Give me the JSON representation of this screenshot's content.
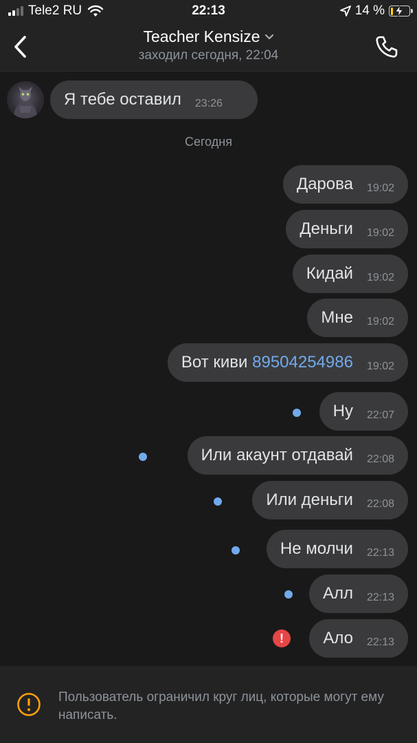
{
  "status_bar": {
    "carrier": "Tele2 RU",
    "time": "22:13",
    "battery": "14 %",
    "battery_level": 0.14
  },
  "header": {
    "title": "Teacher Kensize",
    "last_seen": "заходил сегодня, 22:04"
  },
  "messages": {
    "incoming": {
      "text": "Я тебе оставил",
      "time": "23:26"
    },
    "date_separator": "Сегодня",
    "outgoing": [
      {
        "text": "Дарова",
        "time": "19:02",
        "status": "read"
      },
      {
        "text": "Деньги",
        "time": "19:02",
        "status": "read"
      },
      {
        "text": "Кидай",
        "time": "19:02",
        "status": "read"
      },
      {
        "text": "Мне",
        "time": "19:02",
        "status": "read"
      },
      {
        "text": "Вот киви",
        "link": "89504254986",
        "time": "19:02",
        "status": "read"
      },
      {
        "text": "Ну",
        "time": "22:07",
        "status": "unread"
      },
      {
        "text": "Или акаунт отдавай",
        "time": "22:08",
        "status": "unread"
      },
      {
        "text": "Или деньги",
        "time": "22:08",
        "status": "unread"
      },
      {
        "text": "Не молчи",
        "time": "22:13",
        "status": "unread"
      },
      {
        "text": "Алл",
        "time": "22:13",
        "status": "unread"
      },
      {
        "text": "Ало",
        "time": "22:13",
        "status": "error"
      }
    ]
  },
  "footer": {
    "notice": "Пользователь ограничил круг лиц, которые могут ему написать."
  },
  "colors": {
    "background": "#19191a",
    "bar": "#232324",
    "bubble": "#3a3a3c",
    "accent": "#71aaeb",
    "error": "#e64646",
    "warning": "#ff9f0a"
  },
  "icons": [
    "back-chevron-icon",
    "chevron-down-icon",
    "phone-icon",
    "wifi-icon",
    "location-arrow-icon",
    "battery-icon",
    "error-icon",
    "warning-icon"
  ]
}
